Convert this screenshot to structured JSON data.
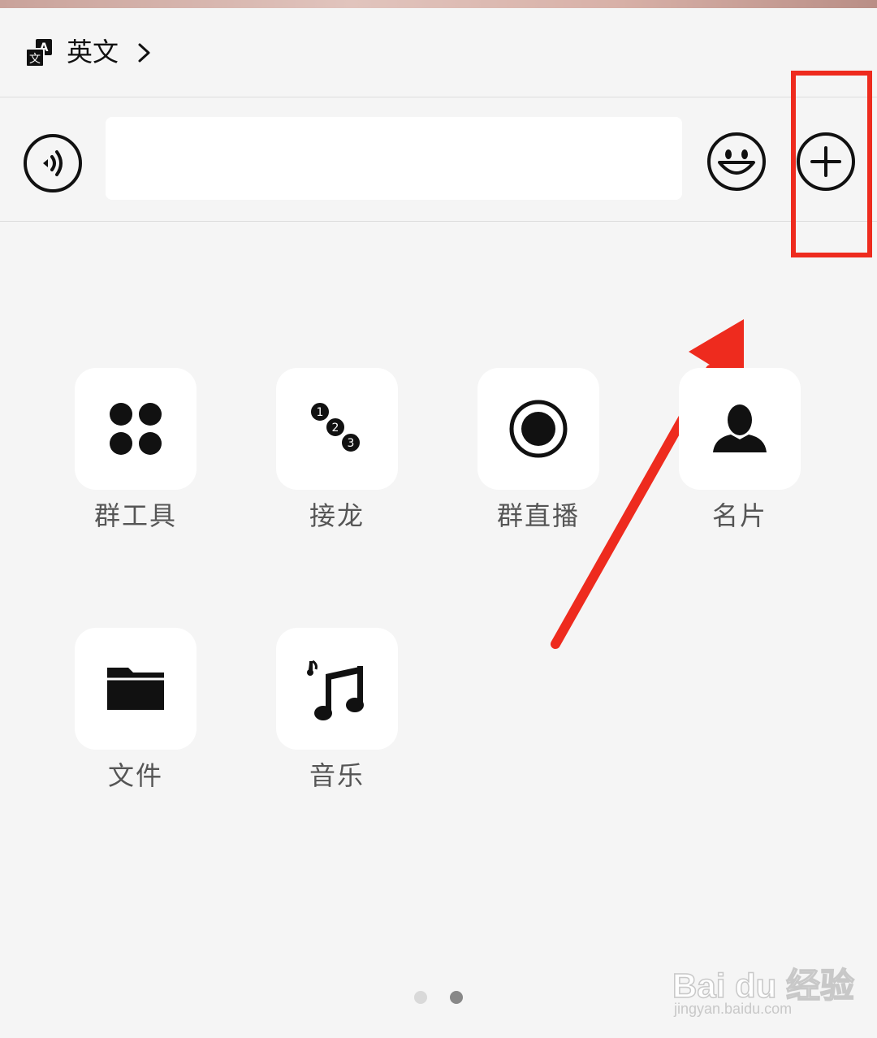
{
  "translate_bar": {
    "language_label": "英文",
    "icon": "translate-icon"
  },
  "input_bar": {
    "voice_icon": "voice-input-icon",
    "text_value": "",
    "emoji_icon": "emoji-icon",
    "plus_icon": "plus-icon"
  },
  "tools": [
    {
      "label": "群工具",
      "icon": "group-tools-icon"
    },
    {
      "label": "接龙",
      "icon": "chain-icon"
    },
    {
      "label": "群直播",
      "icon": "live-icon"
    },
    {
      "label": "名片",
      "icon": "contact-card-icon"
    },
    {
      "label": "文件",
      "icon": "folder-icon"
    },
    {
      "label": "音乐",
      "icon": "music-icon"
    }
  ],
  "pager": {
    "total": 2,
    "active": 2
  },
  "colors": {
    "annotation": "#ee2b1e",
    "background": "#f5f5f5",
    "tile": "#ffffff",
    "label": "#555555"
  },
  "watermark": {
    "brand": "Bai du 经验",
    "url": "jingyan.baidu.com"
  }
}
